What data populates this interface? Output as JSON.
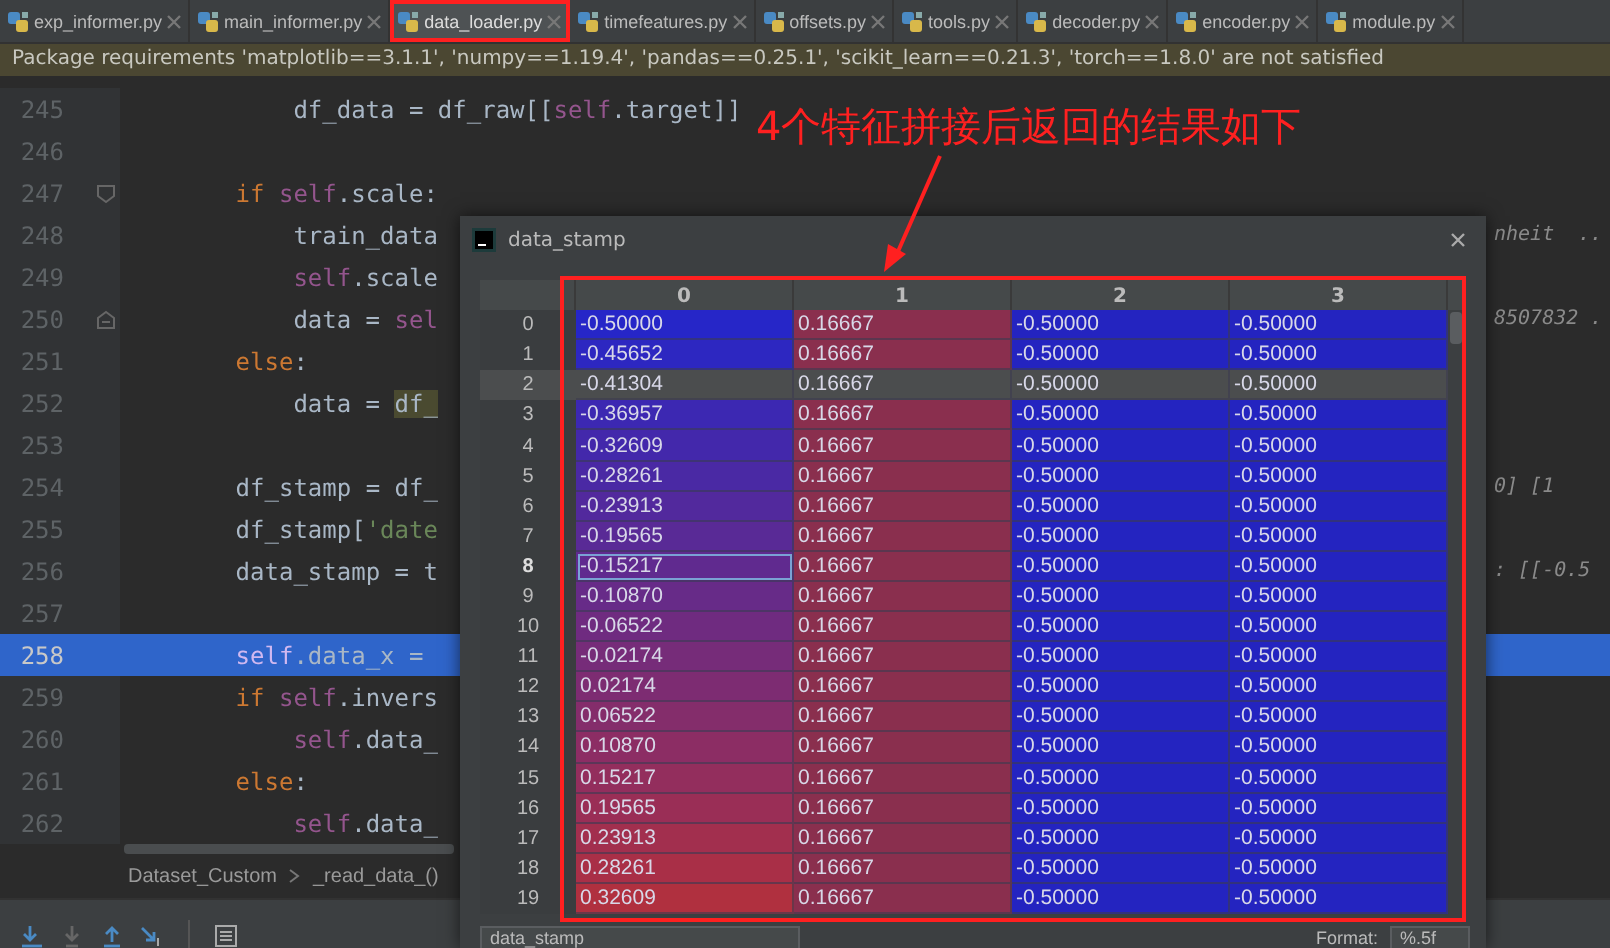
{
  "tabs": [
    {
      "label": "exp_informer.py",
      "selected": false,
      "highlighted": false
    },
    {
      "label": "main_informer.py",
      "selected": false,
      "highlighted": false
    },
    {
      "label": "data_loader.py",
      "selected": true,
      "highlighted": true
    },
    {
      "label": "timefeatures.py",
      "selected": false,
      "highlighted": false
    },
    {
      "label": "offsets.py",
      "selected": false,
      "highlighted": false
    },
    {
      "label": "tools.py",
      "selected": false,
      "highlighted": false
    },
    {
      "label": "decoder.py",
      "selected": false,
      "highlighted": false
    },
    {
      "label": "encoder.py",
      "selected": false,
      "highlighted": false
    },
    {
      "label": "module.py",
      "selected": false,
      "highlighted": false
    }
  ],
  "warning": "Package requirements 'matplotlib==3.1.1', 'numpy==1.19.4', 'pandas==0.25.1', 'scikit_learn==0.21.3', 'torch==1.8.0' are not satisfied",
  "editor": {
    "lines": [
      {
        "number": "245",
        "current": false,
        "nested": true,
        "segments": [
          {
            "text": "df_data = df_raw[[",
            "kind": "plain"
          },
          {
            "text": "self",
            "kind": "self"
          },
          {
            "text": ".target]]",
            "kind": "plain"
          }
        ]
      },
      {
        "number": "246",
        "current": false
      },
      {
        "number": "247",
        "current": false,
        "fold_start": true,
        "nested": false,
        "segments": [
          {
            "text": "if ",
            "kind": "keyword"
          },
          {
            "text": "self",
            "kind": "self"
          },
          {
            "text": ".scale:",
            "kind": "plain"
          }
        ]
      },
      {
        "number": "248",
        "current": false,
        "nested": true,
        "segments": [
          {
            "text": "train_data",
            "kind": "plain"
          }
        ],
        "tail": "nheit  .."
      },
      {
        "number": "249",
        "current": false,
        "nested": true,
        "segments": [
          {
            "text": "self",
            "kind": "self"
          },
          {
            "text": ".scale",
            "kind": "plain"
          }
        ]
      },
      {
        "number": "250",
        "current": false,
        "fold_end": true,
        "nested": true,
        "segments": [
          {
            "text": "data = ",
            "kind": "plain"
          },
          {
            "text": "sel",
            "kind": "self"
          }
        ],
        "tail": "8507832 ."
      },
      {
        "number": "251",
        "current": false,
        "nested": false,
        "segments": [
          {
            "text": "else",
            "kind": "keyword"
          },
          {
            "text": ":",
            "kind": "plain"
          }
        ]
      },
      {
        "number": "252",
        "current": false,
        "nested": true,
        "segments": [
          {
            "text": "data = ",
            "kind": "plain"
          },
          {
            "text": "df_",
            "kind": "match"
          }
        ]
      },
      {
        "number": "253",
        "current": false
      },
      {
        "number": "254",
        "current": false,
        "nested": false,
        "segments": [
          {
            "text": "df_stamp = df_",
            "kind": "plain"
          }
        ],
        "tail": "0] [1"
      },
      {
        "number": "255",
        "current": false,
        "nested": false,
        "segments": [
          {
            "text": "df_stamp[",
            "kind": "plain"
          },
          {
            "text": "'date",
            "kind": "string"
          }
        ]
      },
      {
        "number": "256",
        "current": false,
        "nested": false,
        "segments": [
          {
            "text": "data_stamp = t",
            "kind": "plain"
          }
        ],
        "tail": ": [[-0.5"
      },
      {
        "number": "257",
        "current": false
      },
      {
        "number": "258",
        "current": true,
        "nested": false,
        "segments": [
          {
            "text": "self",
            "kind": "self"
          },
          {
            "text": ".data_x =",
            "kind": "plain"
          }
        ]
      },
      {
        "number": "259",
        "current": false,
        "nested": false,
        "segments": [
          {
            "text": "if ",
            "kind": "keyword"
          },
          {
            "text": "self",
            "kind": "self"
          },
          {
            "text": ".invers",
            "kind": "plain"
          }
        ]
      },
      {
        "number": "260",
        "current": false,
        "nested": true,
        "segments": [
          {
            "text": "self",
            "kind": "self"
          },
          {
            "text": ".data_",
            "kind": "plain"
          }
        ]
      },
      {
        "number": "261",
        "current": false,
        "nested": false,
        "segments": [
          {
            "text": "else",
            "kind": "keyword"
          },
          {
            "text": ":",
            "kind": "plain"
          }
        ]
      },
      {
        "number": "262",
        "current": false,
        "nested": true,
        "segments": [
          {
            "text": "self",
            "kind": "self"
          },
          {
            "text": ".data_",
            "kind": "plain"
          }
        ]
      }
    ]
  },
  "breadcrumb": [
    "Dataset_Custom",
    "_read_data_()"
  ],
  "annotation": "4个特征拼接后返回的结果如下",
  "viewer": {
    "title": "data_stamp",
    "table": {
      "columns": [
        "0",
        "1",
        "2",
        "3"
      ],
      "rows": [
        {
          "index": "0",
          "selected": false,
          "focused": false,
          "cells": [
            {
              "text": "-0.50000",
              "color": "#2626c8"
            },
            {
              "text": "0.16667",
              "color": "#8a2f4e"
            },
            {
              "text": "-0.50000",
              "color": "#2424c0"
            },
            {
              "text": "-0.50000",
              "color": "#2424c0"
            }
          ]
        },
        {
          "index": "1",
          "selected": false,
          "focused": false,
          "cells": [
            {
              "text": "-0.45652",
              "color": "#2d27c1"
            },
            {
              "text": "0.16667",
              "color": "#8a2f4e"
            },
            {
              "text": "-0.50000",
              "color": "#2424c0"
            },
            {
              "text": "-0.50000",
              "color": "#2424c0"
            }
          ]
        },
        {
          "index": "2",
          "selected": true,
          "focused": false,
          "cells": [
            {
              "text": "-0.41304"
            },
            {
              "text": "0.16667"
            },
            {
              "text": "-0.50000"
            },
            {
              "text": "-0.50000"
            }
          ]
        },
        {
          "index": "3",
          "selected": false,
          "focused": false,
          "cells": [
            {
              "text": "-0.36957",
              "color": "#3c28b2"
            },
            {
              "text": "0.16667",
              "color": "#8a2f4e"
            },
            {
              "text": "-0.50000",
              "color": "#2424c0"
            },
            {
              "text": "-0.50000",
              "color": "#2424c0"
            }
          ]
        },
        {
          "index": "4",
          "selected": false,
          "focused": false,
          "cells": [
            {
              "text": "-0.32609",
              "color": "#4328ab"
            },
            {
              "text": "0.16667",
              "color": "#8a2f4e"
            },
            {
              "text": "-0.50000",
              "color": "#2424c0"
            },
            {
              "text": "-0.50000",
              "color": "#2424c0"
            }
          ]
        },
        {
          "index": "5",
          "selected": false,
          "focused": false,
          "cells": [
            {
              "text": "-0.28261",
              "color": "#4a29a4"
            },
            {
              "text": "0.16667",
              "color": "#8a2f4e"
            },
            {
              "text": "-0.50000",
              "color": "#2424c0"
            },
            {
              "text": "-0.50000",
              "color": "#2424c0"
            }
          ]
        },
        {
          "index": "6",
          "selected": false,
          "focused": false,
          "cells": [
            {
              "text": "-0.23913",
              "color": "#52299d"
            },
            {
              "text": "0.16667",
              "color": "#8a2f4e"
            },
            {
              "text": "-0.50000",
              "color": "#2424c0"
            },
            {
              "text": "-0.50000",
              "color": "#2424c0"
            }
          ]
        },
        {
          "index": "7",
          "selected": false,
          "focused": false,
          "cells": [
            {
              "text": "-0.19565",
              "color": "#592a96"
            },
            {
              "text": "0.16667",
              "color": "#8a2f4e"
            },
            {
              "text": "-0.50000",
              "color": "#2424c0"
            },
            {
              "text": "-0.50000",
              "color": "#2424c0"
            }
          ]
        },
        {
          "index": "8",
          "selected": false,
          "focused": true,
          "cells": [
            {
              "text": "-0.15217",
              "color": "#602a8f"
            },
            {
              "text": "0.16667",
              "color": "#8a2f4e"
            },
            {
              "text": "-0.50000",
              "color": "#2424c0"
            },
            {
              "text": "-0.50000",
              "color": "#2424c0"
            }
          ]
        },
        {
          "index": "9",
          "selected": false,
          "focused": false,
          "cells": [
            {
              "text": "-0.10870",
              "color": "#672b88"
            },
            {
              "text": "0.16667",
              "color": "#8a2f4e"
            },
            {
              "text": "-0.50000",
              "color": "#2424c0"
            },
            {
              "text": "-0.50000",
              "color": "#2424c0"
            }
          ]
        },
        {
          "index": "10",
          "selected": false,
          "focused": false,
          "cells": [
            {
              "text": "-0.06522",
              "color": "#6f2b80"
            },
            {
              "text": "0.16667",
              "color": "#8a2f4e"
            },
            {
              "text": "-0.50000",
              "color": "#2424c0"
            },
            {
              "text": "-0.50000",
              "color": "#2424c0"
            }
          ]
        },
        {
          "index": "11",
          "selected": false,
          "focused": false,
          "cells": [
            {
              "text": "-0.02174",
              "color": "#762c79"
            },
            {
              "text": "0.16667",
              "color": "#8a2f4e"
            },
            {
              "text": "-0.50000",
              "color": "#2424c0"
            },
            {
              "text": "-0.50000",
              "color": "#2424c0"
            }
          ]
        },
        {
          "index": "12",
          "selected": false,
          "focused": false,
          "cells": [
            {
              "text": "0.02174",
              "color": "#7d2c72"
            },
            {
              "text": "0.16667",
              "color": "#8a2f4e"
            },
            {
              "text": "-0.50000",
              "color": "#2424c0"
            },
            {
              "text": "-0.50000",
              "color": "#2424c0"
            }
          ]
        },
        {
          "index": "13",
          "selected": false,
          "focused": false,
          "cells": [
            {
              "text": "0.06522",
              "color": "#842d6b"
            },
            {
              "text": "0.16667",
              "color": "#8a2f4e"
            },
            {
              "text": "-0.50000",
              "color": "#2424c0"
            },
            {
              "text": "-0.50000",
              "color": "#2424c0"
            }
          ]
        },
        {
          "index": "14",
          "selected": false,
          "focused": false,
          "cells": [
            {
              "text": "0.10870",
              "color": "#8c2d64"
            },
            {
              "text": "0.16667",
              "color": "#8a2f4e"
            },
            {
              "text": "-0.50000",
              "color": "#2424c0"
            },
            {
              "text": "-0.50000",
              "color": "#2424c0"
            }
          ]
        },
        {
          "index": "15",
          "selected": false,
          "focused": false,
          "cells": [
            {
              "text": "0.15217",
              "color": "#932e5d"
            },
            {
              "text": "0.16667",
              "color": "#8a2f4e"
            },
            {
              "text": "-0.50000",
              "color": "#2424c0"
            },
            {
              "text": "-0.50000",
              "color": "#2424c0"
            }
          ]
        },
        {
          "index": "16",
          "selected": false,
          "focused": false,
          "cells": [
            {
              "text": "0.19565",
              "color": "#9a2e56"
            },
            {
              "text": "0.16667",
              "color": "#8a2f4e"
            },
            {
              "text": "-0.50000",
              "color": "#2424c0"
            },
            {
              "text": "-0.50000",
              "color": "#2424c0"
            }
          ]
        },
        {
          "index": "17",
          "selected": false,
          "focused": false,
          "cells": [
            {
              "text": "0.23913",
              "color": "#a22f4e"
            },
            {
              "text": "0.16667",
              "color": "#8a2f4e"
            },
            {
              "text": "-0.50000",
              "color": "#2424c0"
            },
            {
              "text": "-0.50000",
              "color": "#2424c0"
            }
          ]
        },
        {
          "index": "18",
          "selected": false,
          "focused": false,
          "cells": [
            {
              "text": "0.28261",
              "color": "#a92f47"
            },
            {
              "text": "0.16667",
              "color": "#8a2f4e"
            },
            {
              "text": "-0.50000",
              "color": "#2424c0"
            },
            {
              "text": "-0.50000",
              "color": "#2424c0"
            }
          ]
        },
        {
          "index": "19",
          "selected": false,
          "focused": false,
          "cells": [
            {
              "text": "0.32609",
              "color": "#b0303f"
            },
            {
              "text": "0.16667",
              "color": "#8a2f4e"
            },
            {
              "text": "-0.50000",
              "color": "#2424c0"
            },
            {
              "text": "-0.50000",
              "color": "#2424c0"
            }
          ]
        }
      ]
    },
    "slice": "data_stamp",
    "format_label": "Format:",
    "format": "%.5f"
  }
}
